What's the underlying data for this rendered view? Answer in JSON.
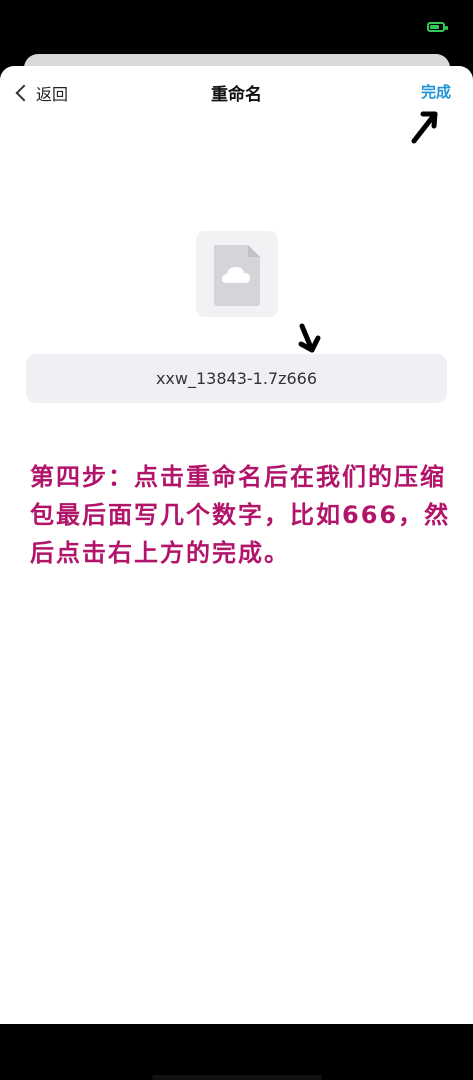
{
  "nav": {
    "back_label": "返回",
    "title": "重命名",
    "done_label": "完成"
  },
  "file": {
    "icon": "cloud-file-icon",
    "name_value": "xxw_13843-1.7z666"
  },
  "instruction": {
    "text": "第四步：点击重命名后在我们的压缩包最后面写几个数字，比如666，然后点击右上方的完成。"
  },
  "colors": {
    "accent": "#1e95d6",
    "annotation_text": "#b2146a",
    "battery": "#34c759"
  }
}
